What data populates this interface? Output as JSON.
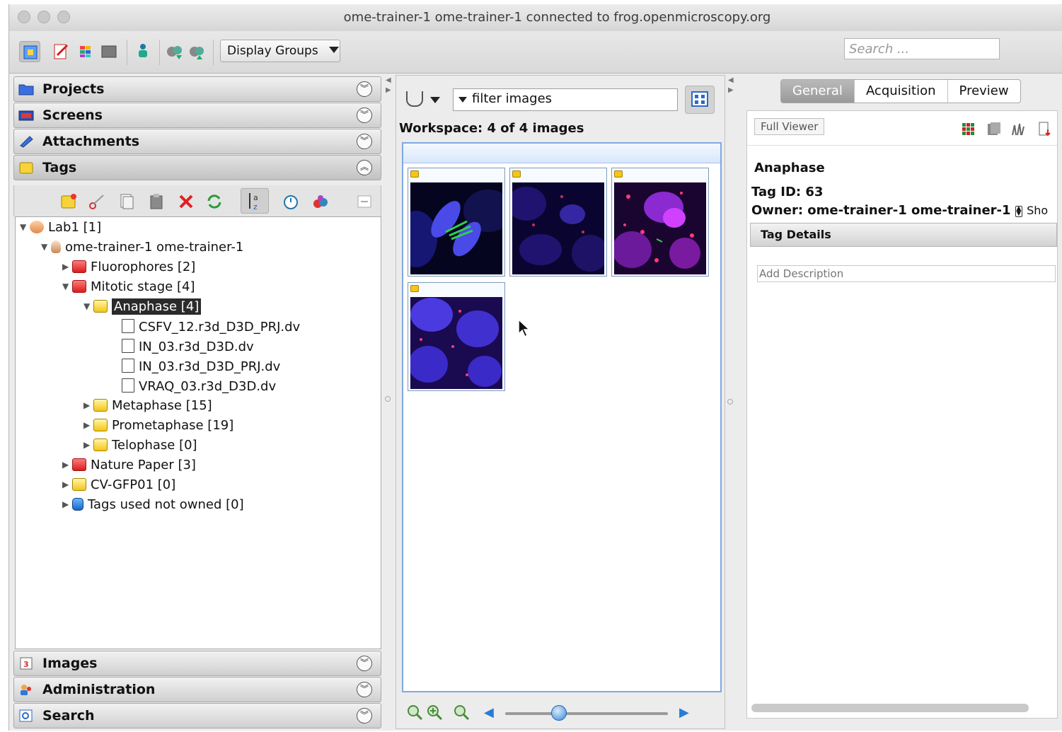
{
  "window": {
    "title": "ome-trainer-1 ome-trainer-1 connected to frog.openmicroscopy.org"
  },
  "toolbar": {
    "display_groups_label": "Display Groups",
    "search_placeholder": "Search ..."
  },
  "left_panel": {
    "sections_top": [
      "Projects",
      "Screens",
      "Attachments",
      "Tags"
    ],
    "sections_bottom": [
      "Images",
      "Administration",
      "Search"
    ],
    "tree": {
      "group": "Lab1 [1]",
      "user": "ome-trainer-1 ome-trainer-1",
      "items": [
        "Fluorophores [2]",
        "Mitotic stage [4]",
        "Anaphase [4]",
        "CSFV_12.r3d_D3D_PRJ.dv",
        "IN_03.r3d_D3D.dv",
        "IN_03.r3d_D3D_PRJ.dv",
        "VRAQ_03.r3d_D3D.dv",
        "Metaphase [15]",
        "Prometaphase [19]",
        "Telophase [0]",
        "Nature Paper [3]",
        "CV-GFP01 [0]",
        "Tags used not owned [0]"
      ]
    }
  },
  "center_panel": {
    "filter_text": "filter  images",
    "workspace_title": "Workspace: 4 of 4 images",
    "zoom_level": 0.33
  },
  "right_panel": {
    "tabs": [
      "General",
      "Acquisition",
      "Preview"
    ],
    "full_viewer_label": "Full Viewer",
    "name": "Anaphase",
    "tag_id": "Tag ID: 63",
    "owner": "Owner: ome-trainer-1 ome-trainer-1",
    "owner_more": "Sho",
    "tag_details_label": "Tag Details",
    "description_placeholder": "Add Description"
  }
}
